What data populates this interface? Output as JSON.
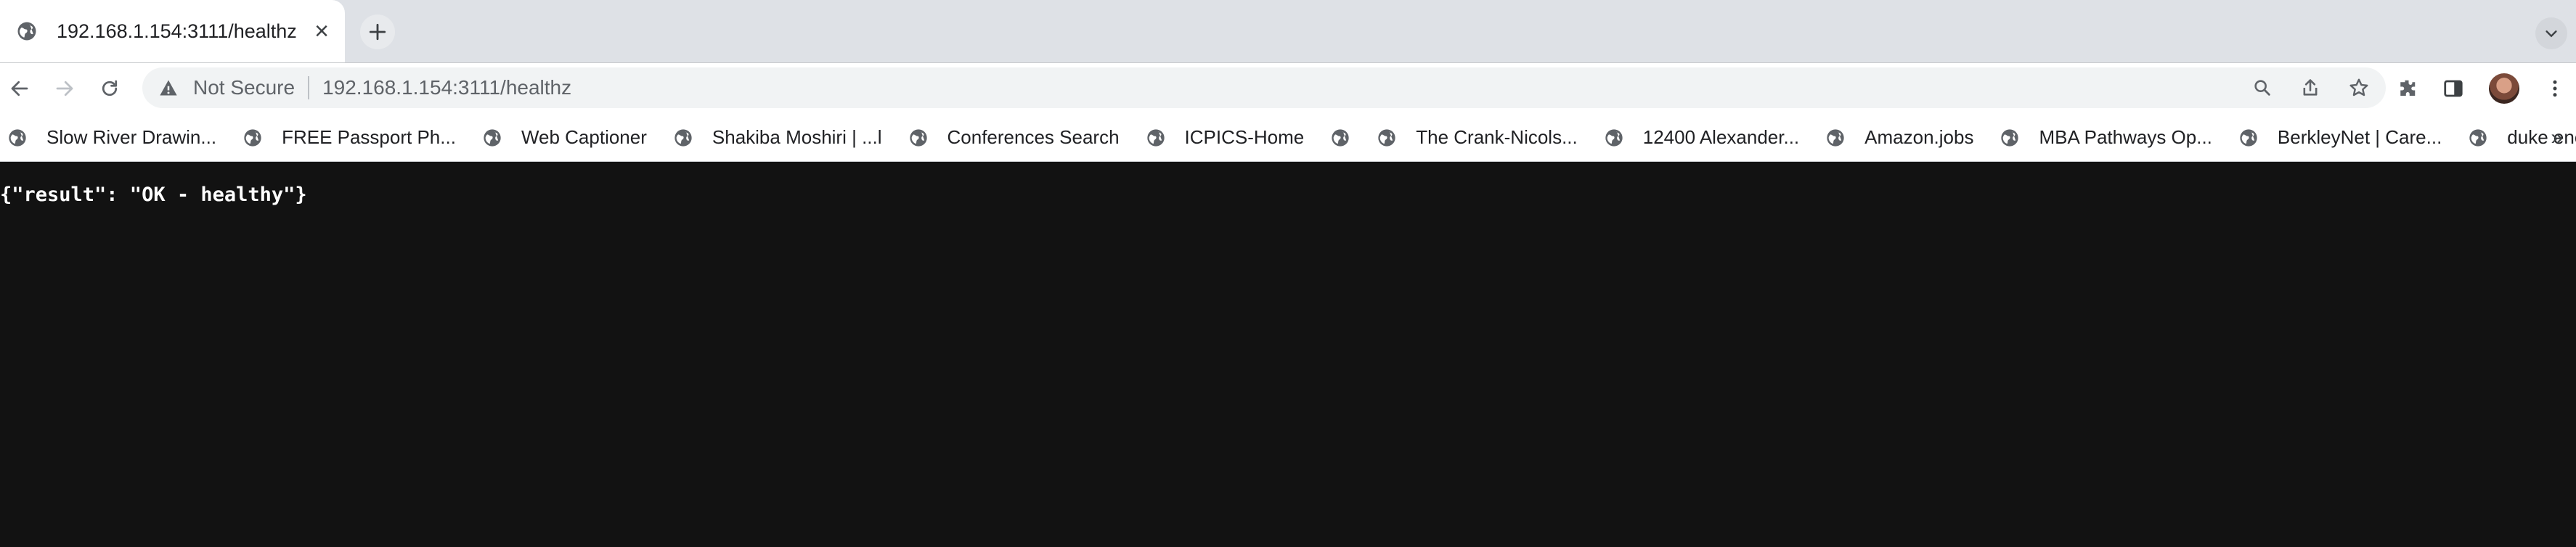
{
  "tab": {
    "title": "192.168.1.154:3111/healthz",
    "close_symbol": "×"
  },
  "omnibox": {
    "security_label": "Not Secure",
    "url_host": "192.168.1.154",
    "url_rest": ":3111/healthz"
  },
  "bookmarks": [
    {
      "label": "Slow River Drawin...",
      "icon": "globe-icon"
    },
    {
      "label": "FREE Passport Ph...",
      "icon": "globe-icon"
    },
    {
      "label": "Web Captioner",
      "icon": "globe-icon"
    },
    {
      "label": "Shakiba Moshiri | ...l",
      "icon": "globe-icon"
    },
    {
      "label": "Conferences Search",
      "icon": "globe-icon"
    },
    {
      "label": "ICPICS-Home",
      "icon": "globe-icon"
    },
    {
      "label": "",
      "icon": "globe-icon"
    },
    {
      "label": "The Crank-Nicols...",
      "icon": "globe-icon"
    },
    {
      "label": "12400 Alexander...",
      "icon": "globe-icon"
    },
    {
      "label": "Amazon.jobs",
      "icon": "globe-icon"
    },
    {
      "label": "MBA Pathways Op...",
      "icon": "globe-icon"
    },
    {
      "label": "BerkleyNet | Care...",
      "icon": "globe-icon"
    },
    {
      "label": "duke energy - Go...",
      "icon": "globe-icon"
    }
  ],
  "bookmarks_overflow": "»",
  "page": {
    "body_text": "{\"result\": \"OK - healthy\"}"
  }
}
